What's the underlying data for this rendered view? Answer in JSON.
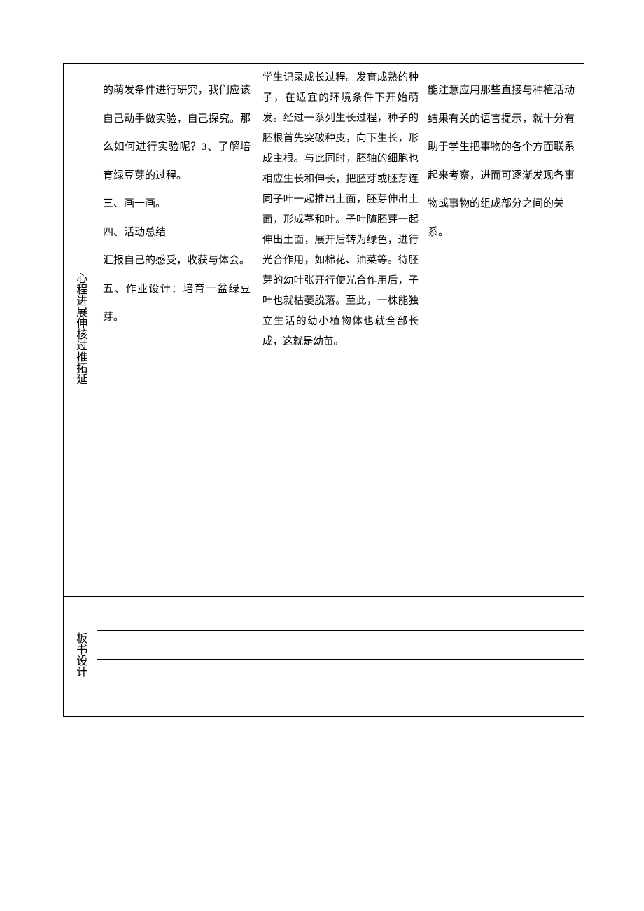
{
  "row1": {
    "label": "心程进展伸核过推拓延",
    "col2": "的萌发条件进行研究，我们应该自己动手做实验，自己探究。那么如何进行实验呢？3、了解培育绿豆芽的过程。\n三、画一画。\n四、活动总结\n汇报自己的感受，收获与体会。\n五、作业设计：培育一盆绿豆芽。",
    "col3": "学生记录成长过程。发育成熟的种子，在适宜的环境条件下开始萌发。经过一系列生长过程，种子的胚根首先突破种皮，向下生长，形成主根。与此同时，胚轴的细胞也相应生长和伸长，把胚芽或胚芽连同子叶一起推出土面，胚芽伸出土面，形成茎和叶。子叶随胚芽一起伸出土面，展开后转为绿色，进行光合作用，如棉花、油菜等。待胚芽的幼叶张开行使光合作用后，子叶也就枯萎脱落。至此，一株能独立生活的幼小植物体也就全部长成，这就是幼苗。",
    "col4": "能注意应用那些直接与种植活动结果有关的语言提示，就十分有助于学生把事物的各个方面联系起来考察，进而可逐渐发现各事物或事物的组成部分之间的关系。"
  },
  "row2": {
    "label": "板书设计"
  }
}
